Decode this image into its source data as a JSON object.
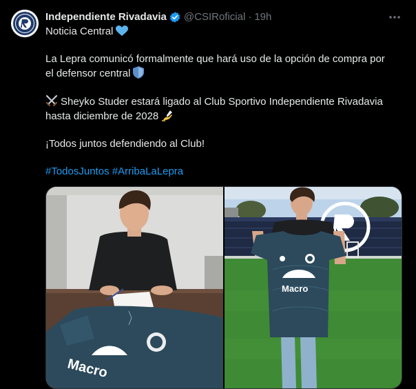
{
  "author": {
    "name": "Independiente Rivadavia",
    "handle": "@CSIRoficial",
    "separator": "·",
    "time": "19h",
    "verified_icon": "verified-badge-icon",
    "avatar_icon": "club-crest-logo"
  },
  "tweet": {
    "lines": [
      "Noticia Central",
      "La Lepra comunicó formalmente que hará uso de la opción de compra por",
      "el defensor central",
      "Sheyko Studer estará ligado al Club Sportivo Independiente Rivadavia",
      "hasta diciembre de 2028",
      "¡Todos juntos defendiendo al Club!"
    ],
    "hashtags": "#TodosJuntos #ArribaLaLepra"
  },
  "media": {
    "photo1_jersey_text": "Macro",
    "photo2_jersey_text": "Macro"
  },
  "colors": {
    "background": "#000000",
    "text": "#e7e9ea",
    "muted": "#71767b",
    "link": "#1d9bf0",
    "jersey": "#2c4a5c"
  }
}
